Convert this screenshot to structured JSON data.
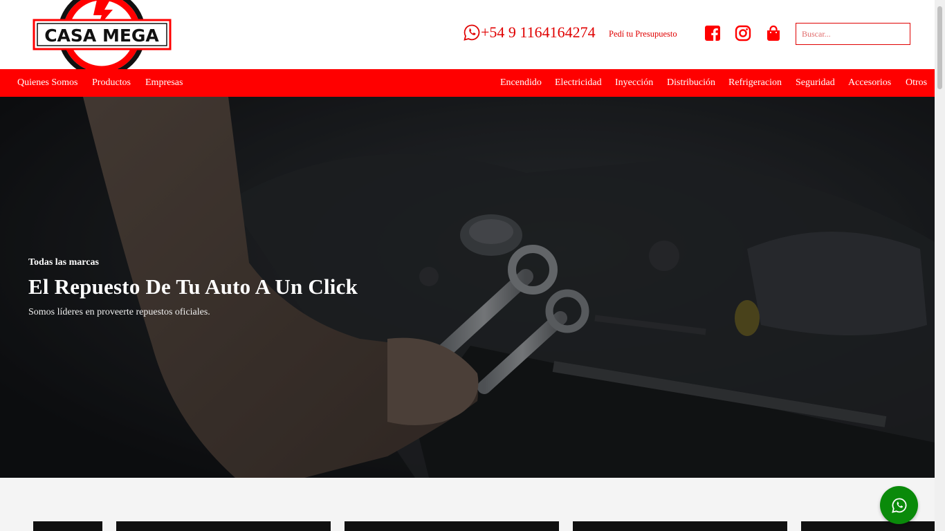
{
  "header": {
    "logo_text": "CASA MEGA",
    "phone": "+54 9 1164164274",
    "quote_link": "Pedí tu Presupuesto",
    "search_placeholder": "Buscar..."
  },
  "nav": {
    "left": [
      "Quienes Somos",
      "Productos",
      "Empresas"
    ],
    "right": [
      "Encendido",
      "Electricidad",
      "Inyección",
      "Distribución",
      "Refrigeracion",
      "Seguridad",
      "Accesorios",
      "Otros"
    ]
  },
  "hero": {
    "subtitle": "Todas las marcas",
    "title": "El Repuesto De Tu Auto A Un Click",
    "description": "Somos líderes en proveerte repuestos oficiales."
  },
  "colors": {
    "brand_red": "#ff0000",
    "whatsapp_green": "#0a8a0a"
  },
  "icons": [
    "whatsapp-icon",
    "facebook-icon",
    "instagram-icon",
    "shopping-bag-icon",
    "whatsapp-float-icon"
  ]
}
